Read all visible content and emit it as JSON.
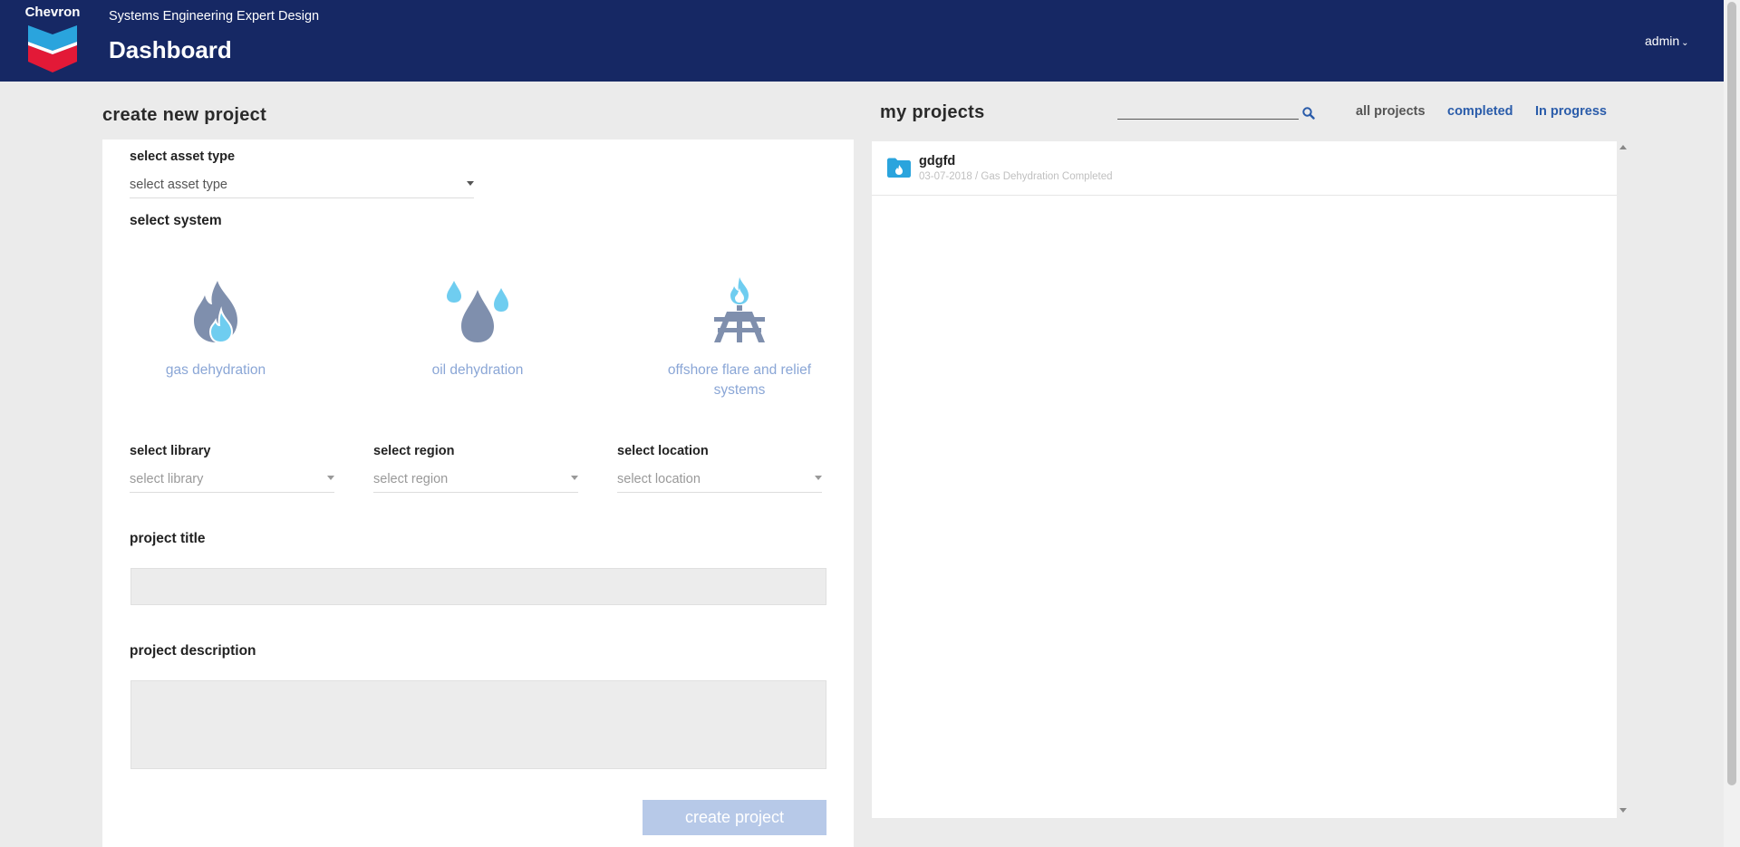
{
  "header": {
    "brand": "Chevron",
    "app_subtitle": "Systems Engineering Expert Design",
    "page_title": "Dashboard",
    "user_label": "admin",
    "colors": {
      "bar": "#162864"
    }
  },
  "create": {
    "title": "create new project",
    "asset_type": {
      "label": "select asset type",
      "value": "select asset type"
    },
    "system_label": "select system",
    "systems": [
      {
        "label": "gas dehydration",
        "icon": "flame-icon"
      },
      {
        "label": "oil dehydration",
        "icon": "droplets-icon"
      },
      {
        "label": "offshore flare and relief systems",
        "icon": "flare-platform-icon"
      }
    ],
    "library": {
      "label": "select library",
      "value": "select library"
    },
    "region": {
      "label": "select region",
      "value": "select region"
    },
    "location": {
      "label": "select location",
      "value": "select location"
    },
    "project_title_label": "project title",
    "project_title_value": "",
    "project_description_label": "project description",
    "project_description_value": "",
    "create_button": "create project",
    "colors": {
      "system_label": "#8aa6d6",
      "button": "#b7c9e8"
    }
  },
  "projects": {
    "title": "my projects",
    "search_value": "",
    "filters": [
      "all projects",
      "completed",
      "In progress"
    ],
    "items": [
      {
        "name": "gdgfd",
        "meta": "03-07-2018 / Gas Dehydration Completed",
        "icon": "folder-flame-icon"
      }
    ]
  }
}
